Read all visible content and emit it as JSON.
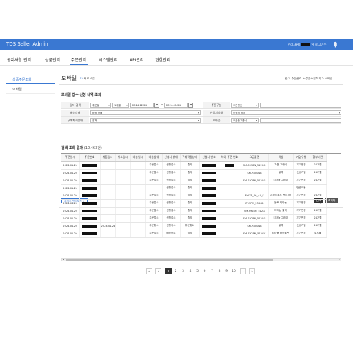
{
  "header": {
    "title": "TDS Seller Admin",
    "user_prefix": "관리자님(",
    "user_suffix": "님 로그아웃)"
  },
  "gnb": [
    "공지사항 관리",
    "상품관리",
    "주문관리",
    "시스템관리",
    "API관리",
    "권한관리"
  ],
  "lnb": [
    "상품주문조회",
    "모바일"
  ],
  "page": {
    "title": "모바일",
    "refresh_label": "새로고침",
    "breadcrumb": "홈 > 주문관리 > 상품주문조회 > 모바일"
  },
  "filter": {
    "section_title": "모바일 접수 신청 내역 조회",
    "period_label": "일자 검색",
    "period_type": "주문일",
    "period_range": "1개월",
    "date_from": "2024-12-24",
    "date_to": "2024-01-24",
    "order_type_label": "주문구분",
    "order_type_value": "주문번호",
    "delivery_status_label": "배송상태",
    "delivery_status_value": "배송 상태",
    "apply_status_label": "신청처상태",
    "apply_status_value": "신청서 상태",
    "purchase_type_label": "구매폐쇄상태",
    "purchase_type_value": "전체",
    "agency_label": "모바폴",
    "agency_value": "요금폴그룹너",
    "detail_button": "상세조건 더보기 +",
    "search_button": "검색",
    "reset_button": "초기화"
  },
  "results": {
    "title": "검색 조회 결과",
    "count": "(10,463건)"
  },
  "table": {
    "headers": [
      "주문일시",
      "주문번호",
      "개통일시",
      "취소일시",
      "배송일시",
      "배송상태",
      "신청서 상태",
      "구매확정상태",
      "신청서 번호",
      "해외 주문 번호",
      "요금플랜",
      "색상",
      "가입유형",
      "할부기간"
    ],
    "rows": [
      [
        "2024-01-24",
        "1",
        "",
        "",
        "",
        "주문접수",
        "신청접수",
        "줍의",
        "1",
        "1",
        "SM-S938N_512GG",
        "가을 그레이",
        "기기변경",
        "24개월"
      ],
      [
        "2024-01-24",
        "1",
        "",
        "",
        "",
        "주문접수",
        "신청접수",
        "줍의",
        "1",
        "",
        "SM-R600NB",
        "블랙",
        "신규가입",
        "24개월"
      ],
      [
        "2024-01-24",
        "1",
        "",
        "",
        "",
        "주문접수",
        "신청접수",
        "줍의",
        "1",
        "",
        "SM-S928N_512GG",
        "티타늄 그레이",
        "기기변경",
        "24개월"
      ],
      [
        "2024-01-24",
        "1",
        "",
        "",
        "",
        "",
        "신청접수",
        "줍의",
        "1",
        "",
        "",
        "",
        "번호이동",
        ""
      ],
      [
        "2024-01-24",
        "1",
        "",
        "",
        "",
        "주문접수",
        "신청접수",
        "줍의",
        "1",
        "",
        "AWXB_46_AL_S",
        "은하스포츠 밴드 (Q",
        "기기변경",
        "24개월"
      ],
      [
        "2024-01-24",
        "1",
        "",
        "",
        "",
        "주문접수",
        "신청접수",
        "줍의",
        "1",
        "",
        "IP15PM_256GB",
        "블랙 티타늄",
        "기기변경",
        "12개월"
      ],
      [
        "2024-01-24",
        "1",
        "",
        "",
        "",
        "주문접수",
        "신청접수",
        "줍의",
        "1",
        "",
        "SM-S928N_512G",
        "티타늄 블랙",
        "기기변경",
        "24개월"
      ],
      [
        "2024-01-24",
        "1",
        "",
        "",
        "",
        "주문접수",
        "신청접수",
        "줍의",
        "1",
        "",
        "SM-S928N_512GG",
        "티타늄 그레이",
        "기기변경",
        "24개월"
      ],
      [
        "2024-01-24",
        "1",
        "2024-01-24",
        "",
        "",
        "주문취소",
        "신청취소",
        "주문취소",
        "1",
        "",
        "SM-R600NB",
        "블랙",
        "신규가입",
        "24개월"
      ],
      [
        "2024-01-24",
        "1",
        "",
        "",
        "",
        "주문접수",
        "배송보류",
        "줍의",
        "1",
        "",
        "SM-S928N_512GV",
        "티타늄 바이올렛",
        "기기변경",
        "일시불"
      ]
    ]
  },
  "pager": {
    "first": "«",
    "prev": "‹",
    "pages": [
      "1",
      "2",
      "3",
      "4",
      "5",
      "6",
      "7",
      "8",
      "9",
      "10"
    ],
    "next": "›",
    "last": "»",
    "active": "1"
  }
}
